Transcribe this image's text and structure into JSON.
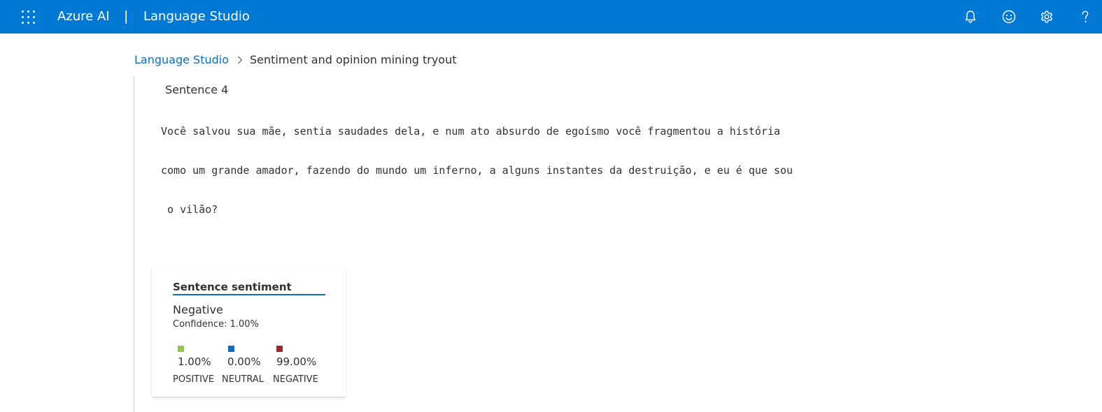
{
  "header": {
    "brand": "Azure AI",
    "separator": "|",
    "product": "Language Studio"
  },
  "header_icons": [
    "bell-icon",
    "smiley-icon",
    "gear-icon",
    "help-icon"
  ],
  "breadcrumb": {
    "root": "Language Studio",
    "current": "Sentiment and opinion mining tryout"
  },
  "sentence": {
    "title": "Sentence 4",
    "lines": [
      "Você salvou sua mãe, sentia saudades dela, e num ato absurdo de egoísmo você fragmentou a história",
      "como um grande amador, fazendo do mundo um inferno, a alguns instantes da destruição, e eu é que sou",
      " o vilão?"
    ]
  },
  "sentiment_card": {
    "title": "Sentence sentiment",
    "label": "Negative",
    "confidence": "Confidence: 1.00%",
    "scores": [
      {
        "value": "1.00%",
        "name": "POSITIVE",
        "color": "#92c353"
      },
      {
        "value": "0.00%",
        "name": "NEUTRAL",
        "color": "#0f6cbd"
      },
      {
        "value": "99.00%",
        "name": "NEGATIVE",
        "color": "#a4262c"
      }
    ]
  },
  "colors": {
    "header_bg": "#0078d4",
    "link": "#0f6cbd",
    "text": "#323130"
  }
}
